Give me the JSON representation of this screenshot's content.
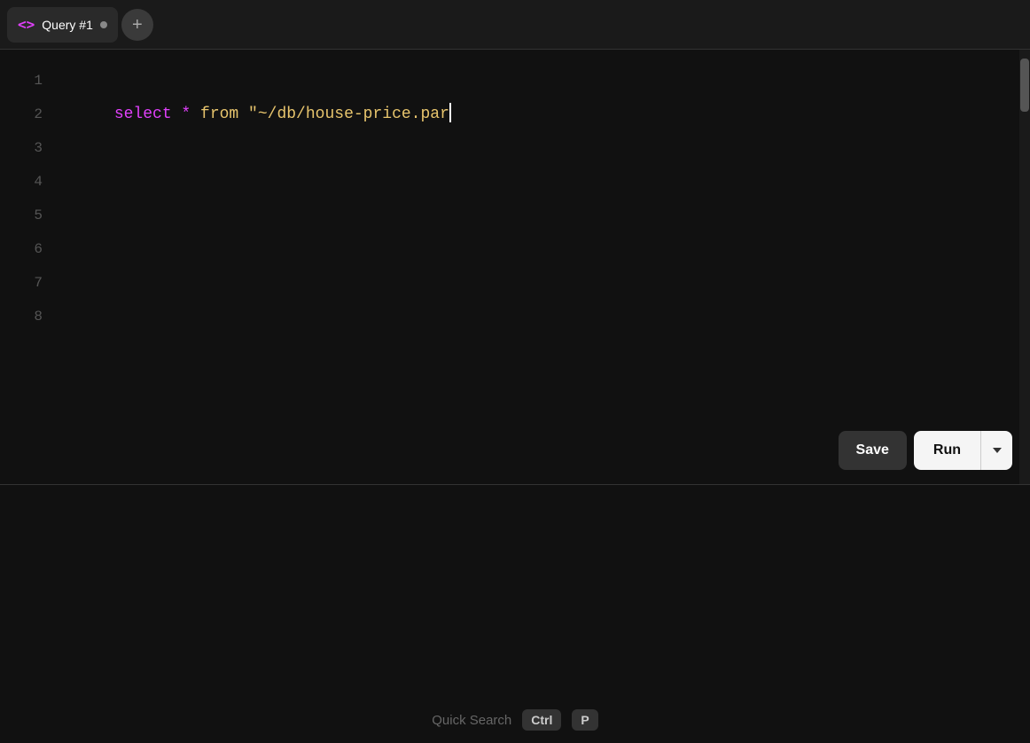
{
  "tab": {
    "icon": "<>",
    "title": "Query #1",
    "dot_color": "#888888"
  },
  "add_tab_label": "+",
  "editor": {
    "line_numbers": [
      "1",
      "2",
      "3",
      "4",
      "5",
      "6",
      "7",
      "8"
    ],
    "code_tokens": [
      {
        "text": "select",
        "class": "kw-select"
      },
      {
        "text": " * ",
        "class": "kw-star"
      },
      {
        "text": "from",
        "class": "kw-from"
      },
      {
        "text": " \"~/db/house-price.par",
        "class": "kw-string"
      }
    ]
  },
  "toolbar": {
    "save_label": "Save",
    "run_label": "Run"
  },
  "status_bar": {
    "quick_search_label": "Quick Search",
    "kbd1": "Ctrl",
    "kbd2": "P"
  }
}
